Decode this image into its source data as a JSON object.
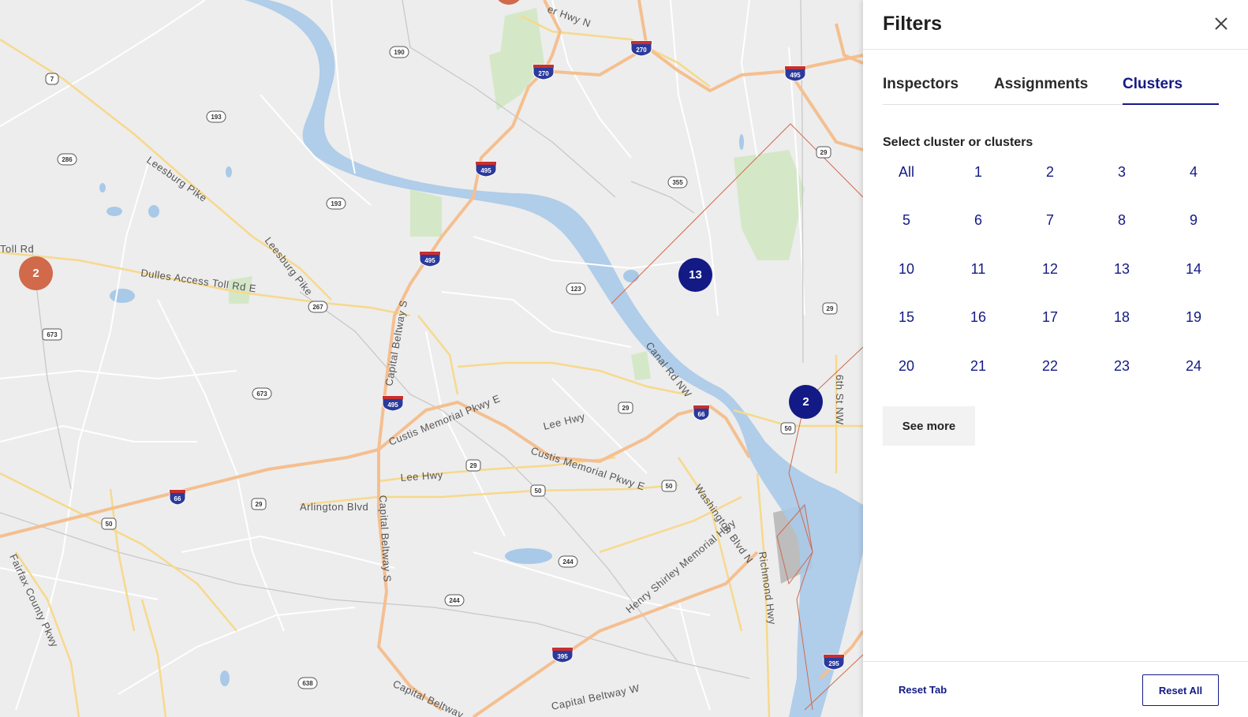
{
  "map": {
    "road_labels": {
      "toll_rd": "Toll Rd",
      "dulles": "Dulles Access Toll Rd E",
      "leesburg1": "Leesburg Pike",
      "leesburg2": "Leesburg Pike",
      "capital1": "Capital Beltway S",
      "capital2": "Capital Beltway S",
      "capital3": "Capital Beltway",
      "capital4": "Capital Beltway W",
      "custis1": "Custis Memorial Pkwy E",
      "custis2": "Custis Memorial Pkwy E",
      "lee1": "Lee Hwy",
      "lee2": "Lee Hwy",
      "arlington": "Arlington Blvd",
      "canal": "Canal Rd NW",
      "washington": "Washington Blvd N",
      "henry": "Henry Shirley Memorial Hwy",
      "richmond": "Richmond Hwy",
      "sixth": "6th St NW",
      "fairfax": "Fairfax County Pkwy",
      "hwy_n": "er Hwy N"
    },
    "shields": {
      "s190": "190",
      "s7": "7",
      "s193a": "193",
      "s193b": "193",
      "s286": "286",
      "s267": "267",
      "s673a": "673",
      "s673b": "673",
      "s123": "123",
      "s355": "355",
      "s29a": "29",
      "s29b": "29",
      "s29c": "29",
      "s29d": "29",
      "s29e": "29",
      "s50a": "50",
      "s50b": "50",
      "s50c": "50",
      "s50d": "50",
      "s244a": "244",
      "s244b": "244",
      "s638": "638"
    },
    "interstates": {
      "i270a": "270",
      "i270b": "270",
      "i495a": "495",
      "i495b": "495",
      "i495c": "495",
      "i495d": "495",
      "i66a": "66",
      "i66b": "66",
      "i395": "395",
      "i295": "295"
    },
    "markers": [
      {
        "label": "2",
        "color": "#d06a4b"
      },
      {
        "label": "13",
        "color": "#131a85"
      },
      {
        "label": "2",
        "color": "#131a85"
      }
    ]
  },
  "panel": {
    "title": "Filters",
    "tabs": [
      {
        "label": "Inspectors"
      },
      {
        "label": "Assignments"
      },
      {
        "label": "Clusters"
      }
    ],
    "section_label": "Select cluster or clusters",
    "cluster_options": [
      "All",
      "1",
      "2",
      "3",
      "4",
      "5",
      "6",
      "7",
      "8",
      "9",
      "10",
      "11",
      "12",
      "13",
      "14",
      "15",
      "16",
      "17",
      "18",
      "19",
      "20",
      "21",
      "22",
      "23",
      "24"
    ],
    "see_more": "See more",
    "reset_tab": "Reset Tab",
    "reset_all": "Reset All"
  },
  "colors": {
    "accent": "#131a85",
    "marker_orange": "#d06a4b",
    "water": "#a9c9e8",
    "park": "#cfe5c3",
    "major_road": "#f5c68d",
    "highway": "#f2b48a"
  }
}
